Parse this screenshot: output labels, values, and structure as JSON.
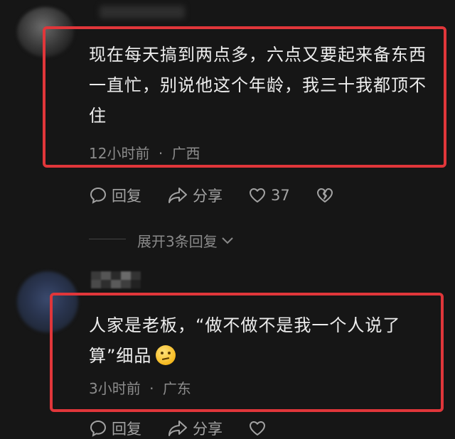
{
  "comments": [
    {
      "text_line1": "现在每天搞到两点多，六点又要起来备东西",
      "text_line2": "一直忙，别说他这个年龄，我三十我都顶不",
      "text_line3": "住",
      "time": "12小时前",
      "separator": "·",
      "location": "广西",
      "actions": {
        "reply_label": "回复",
        "share_label": "分享",
        "like_count": "37"
      },
      "expand_label": "展开3条回复"
    },
    {
      "text_line1": "人家是老板，“做不做不是我一个人说了",
      "text_line2": "算”细品",
      "emoji_icon": "thinking-face-emoji",
      "time": "3小时前",
      "separator": "·",
      "location": "广东",
      "actions": {
        "reply_label": "回复",
        "share_label": "分享"
      }
    }
  ],
  "colors": {
    "background": "#161616",
    "highlight_border": "#e0363a",
    "text": "#ededed",
    "meta": "#8c8c8c"
  }
}
